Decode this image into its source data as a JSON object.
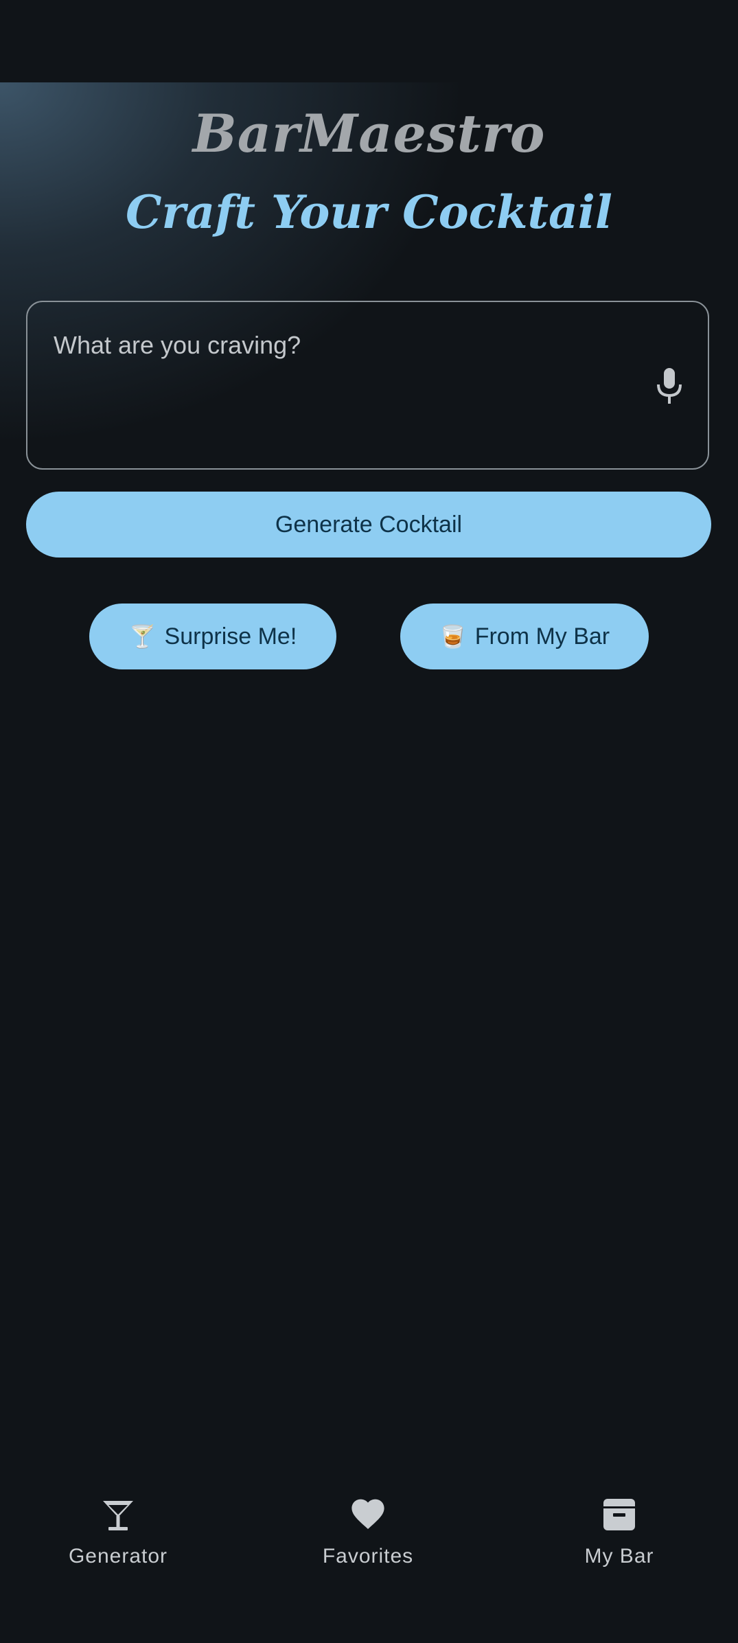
{
  "app": {
    "brand": "BarMaestro",
    "headline": "Craft Your Cocktail"
  },
  "craving_input": {
    "value": "",
    "placeholder": "What are you craving?",
    "mic_icon": "microphone-icon"
  },
  "actions": {
    "generate_label": "Generate Cocktail",
    "surprise_emoji": "🍸",
    "surprise_label": "Surprise Me!",
    "frombar_emoji": "🥃",
    "frombar_label": "From My Bar"
  },
  "bottom_nav": {
    "items": [
      {
        "label": "Generator",
        "icon": "martini-glass-icon"
      },
      {
        "label": "Favorites",
        "icon": "heart-icon"
      },
      {
        "label": "My Bar",
        "icon": "archive-box-icon"
      }
    ]
  },
  "colors": {
    "background": "#101418",
    "accent": "#8ecdf2",
    "on_accent": "#0e3248",
    "brand_text": "#a3a7ab",
    "nav_text": "#c9cdd1"
  }
}
